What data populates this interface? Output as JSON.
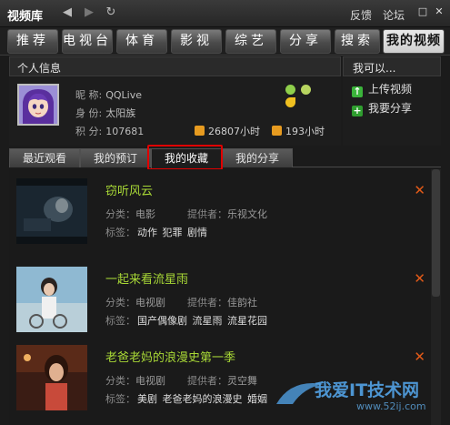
{
  "titlebar": {
    "app_title": "视频库",
    "back_icon": "arrow-left-icon",
    "forward_icon": "arrow-right-icon",
    "refresh_icon": "refresh-icon",
    "feedback": "反馈",
    "forum": "论坛"
  },
  "tabs": [
    {
      "label": "推荐"
    },
    {
      "label": "电视台"
    },
    {
      "label": "体育"
    },
    {
      "label": "影视"
    },
    {
      "label": "综艺"
    },
    {
      "label": "分享"
    },
    {
      "label": "搜索"
    },
    {
      "label": "我的视频"
    }
  ],
  "profile": {
    "header": "个人信息",
    "nickname_label": "昵 称:",
    "nickname": "QQLive",
    "identity_label": "身 份:",
    "identity": "太阳族",
    "points_label": "积 分:",
    "points": "107681",
    "hours_1": "26807小时",
    "hours_2": "193小时"
  },
  "actions": {
    "header": "我可以...",
    "upload": "上传视频",
    "share": "我要分享"
  },
  "subtabs": [
    {
      "label": "最近观看"
    },
    {
      "label": "我的预订"
    },
    {
      "label": "我的收藏"
    },
    {
      "label": "我的分享"
    }
  ],
  "items": [
    {
      "title": "窃听风云",
      "category_label": "分类：",
      "category": "电影",
      "provider_label": "提供者：",
      "provider": "乐视文化",
      "tags_label": "标签：",
      "tags": [
        "动作",
        "犯罪",
        "剧情"
      ]
    },
    {
      "title": "一起来看流星雨",
      "category_label": "分类：",
      "category": "电视剧",
      "provider_label": "提供者：",
      "provider": "佳韵社",
      "tags_label": "标签：",
      "tags": [
        "国产偶像剧",
        "流星雨",
        "流星花园"
      ]
    },
    {
      "title": "老爸老妈的浪漫史第一季",
      "category_label": "分类：",
      "category": "电视剧",
      "provider_label": "提供者：",
      "provider": "灵空舞",
      "tags_label": "标签：",
      "tags": [
        "美剧",
        "老爸老妈的浪漫史",
        "婚姻"
      ]
    }
  ],
  "watermark": {
    "text": "我爱IT技术网",
    "url": "www.52ij.com"
  },
  "colors": {
    "title_green": "#a8d836",
    "delete_orange": "#e25a18",
    "highlight_red": "#e00000"
  }
}
